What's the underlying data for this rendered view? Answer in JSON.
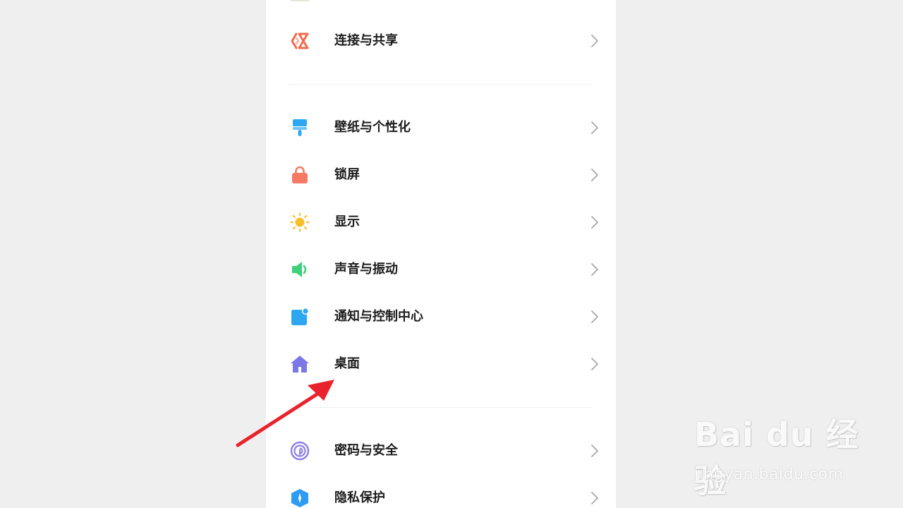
{
  "settings": {
    "items": [
      {
        "label": "连接与共享",
        "icon": "share-icon",
        "color": "#f26b4f"
      },
      {
        "label": "壁纸与个性化",
        "icon": "brush-icon",
        "color": "#2ea7f2"
      },
      {
        "label": "锁屏",
        "icon": "lock-icon",
        "color": "#f47a64"
      },
      {
        "label": "显示",
        "icon": "sun-icon",
        "color": "#f9bf2b"
      },
      {
        "label": "声音与振动",
        "icon": "speaker-icon",
        "color": "#3ed07a"
      },
      {
        "label": "通知与控制中心",
        "icon": "notification-icon",
        "color": "#2ea7f2"
      },
      {
        "label": "桌面",
        "icon": "home-icon",
        "color": "#7b78e6"
      },
      {
        "label": "密码与安全",
        "icon": "fingerprint-icon",
        "color": "#8f7ee8"
      },
      {
        "label": "隐私保护",
        "icon": "privacy-icon",
        "color": "#2e9cf2"
      }
    ]
  },
  "annotation": {
    "color": "#e8232b"
  },
  "watermark": {
    "logo": "Bai du 经验",
    "url": "jingyan.baidu.com"
  }
}
